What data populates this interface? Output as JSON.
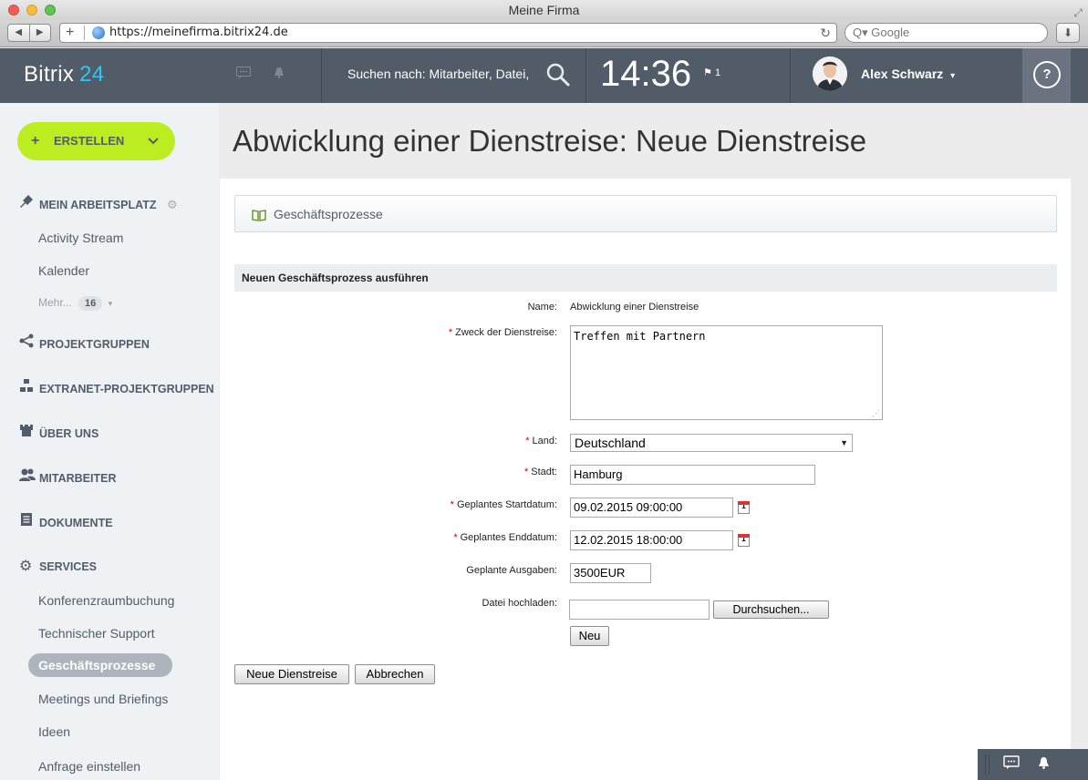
{
  "browser": {
    "window_title": "Meine Firma",
    "url": "https://meinefirma.bitrix24.de",
    "search_placeholder": "Google",
    "nav_back": "◀",
    "nav_forward": "▶",
    "url_plus": "+",
    "reload": "↻",
    "search_glyph": "Q▾",
    "download": "⬇"
  },
  "header": {
    "logo_text": "Bitrix",
    "logo_num": "24",
    "search_text": "Suchen nach: Mitarbeiter, Datei,",
    "time": "14:36",
    "flag_count": "1",
    "user_name": "Alex Schwarz",
    "user_caret": "▾",
    "help": "?"
  },
  "sidebar": {
    "create_label": "ERSTELLEN",
    "create_plus": "+",
    "create_chev": "⌄",
    "my_workspace": "MEIN ARBEITSPLATZ",
    "activity_stream": "Activity Stream",
    "calendar": "Kalender",
    "more_label": "Mehr...",
    "more_count": "16",
    "more_caret": "▾",
    "project_groups": "PROJEKTGRUPPEN",
    "extranet_groups": "EXTRANET-PROJEKTGRUPPEN",
    "about_us": "ÜBER UNS",
    "employees": "MITARBEITER",
    "documents": "DOKUMENTE",
    "services": "SERVICES",
    "conference": "Konferenzraumbuchung",
    "tech_support": "Technischer Support",
    "business_processes": "Geschäftsprozesse",
    "meetings": "Meetings und Briefings",
    "ideas": "Ideen",
    "request": "Anfrage einstellen"
  },
  "main": {
    "page_title": "Abwicklung einer Dienstreise: Neue Dienstreise",
    "bp_bar": "Geschäftsprozesse",
    "form_head": "Neuen Geschäftsprozess ausführen",
    "required_mark": "*",
    "name_label": "Name:",
    "name_value": "Abwicklung einer Dienstreise",
    "purpose_label": "Zweck der Dienstreise:",
    "purpose_value": "Treffen mit Partnern",
    "country_label": "Land:",
    "country_value": "Deutschland",
    "city_label": "Stadt:",
    "city_value": "Hamburg",
    "start_label": "Geplantes Startdatum:",
    "start_value": "09.02.2015 09:00:00",
    "end_label": "Geplantes Enddatum:",
    "end_value": "12.02.2015 18:00:00",
    "expenses_label": "Geplante Ausgaben:",
    "expenses_value": "3500EUR",
    "upload_label": "Datei hochladen:",
    "browse_button": "Durchsuchen...",
    "new_button": "Neu",
    "submit_button": "Neue Dienstreise",
    "cancel_button": "Abbrechen",
    "calendar_day": "1"
  }
}
